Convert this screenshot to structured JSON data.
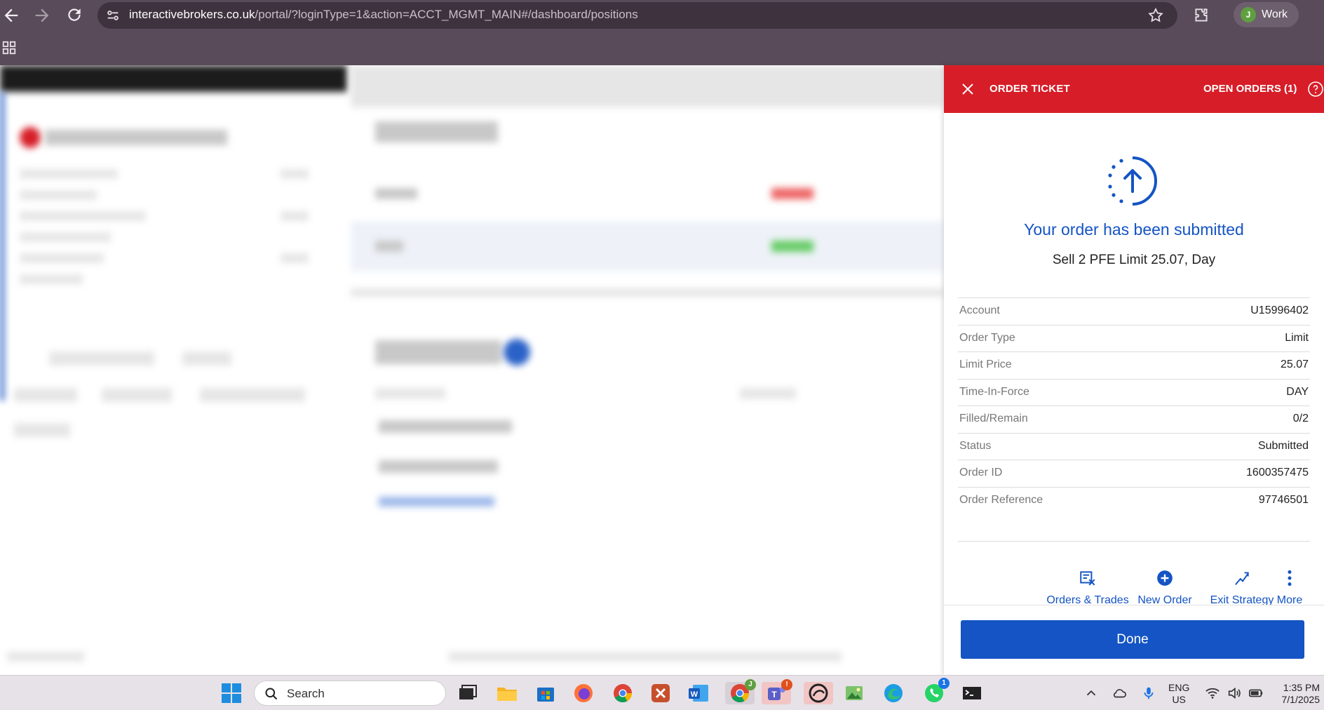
{
  "browser": {
    "url_host": "interactivebrokers.co.uk",
    "url_path": "/portal/?loginType=1&action=ACCT_MGMT_MAIN#/dashboard/positions",
    "profile_initial": "J",
    "profile_label": "Work"
  },
  "ticket": {
    "title": "ORDER TICKET",
    "open_orders": "OPEN ORDERS (1)",
    "submitted_title": "Your order has been submitted",
    "summary": "Sell 2 PFE Limit 25.07, Day",
    "details": [
      {
        "label": "Account",
        "value": "U15996402"
      },
      {
        "label": "Order Type",
        "value": "Limit"
      },
      {
        "label": "Limit Price",
        "value": "25.07"
      },
      {
        "label": "Time-In-Force",
        "value": "DAY"
      },
      {
        "label": "Filled/Remain",
        "value": "0/2"
      },
      {
        "label": "Status",
        "value": "Submitted"
      },
      {
        "label": "Order ID",
        "value": "1600357475"
      },
      {
        "label": "Order Reference",
        "value": "97746501"
      }
    ],
    "actions": [
      {
        "label": "Orders & Trades",
        "icon": "orders-trades-icon"
      },
      {
        "label": "New Order",
        "icon": "plus-circle-icon"
      },
      {
        "label": "Exit Strategy",
        "icon": "exit-strategy-icon"
      },
      {
        "label": "More",
        "icon": "more-vertical-icon"
      }
    ],
    "done_label": "Done",
    "accent_color": "#d71e28",
    "primary_color": "#1454c4"
  },
  "taskbar": {
    "search_label": "Search",
    "lang_line1": "ENG",
    "lang_line2": "US",
    "time": "1:35 PM",
    "date": "7/1/2025",
    "teams_badge": "!",
    "whatsapp_badge": "1",
    "chrome_badge": "J"
  }
}
